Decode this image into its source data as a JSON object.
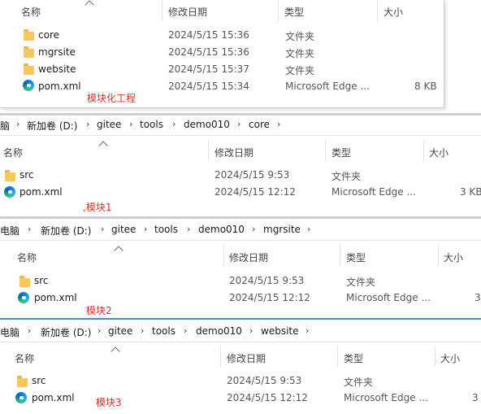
{
  "columns": {
    "name": "名称",
    "modified": "修改日期",
    "type": "类型",
    "size": "大小"
  },
  "panel1": {
    "rows": [
      {
        "name": "core",
        "date": "2024/5/15 15:36",
        "type": "文件夹",
        "size": "",
        "icon": "folder-icon"
      },
      {
        "name": "mgrsite",
        "date": "2024/5/15 15:36",
        "type": "文件夹",
        "size": "",
        "icon": "folder-icon"
      },
      {
        "name": "website",
        "date": "2024/5/15 15:37",
        "type": "文件夹",
        "size": "",
        "icon": "folder-icon"
      },
      {
        "name": "pom.xml",
        "date": "2024/5/15 15:34",
        "type": "Microsoft Edge ...",
        "size": "8 KB",
        "icon": "edge-file-icon"
      }
    ],
    "annotation": "模块化工程"
  },
  "panel2": {
    "breadcrumb": [
      "脑",
      "新加卷 (D:)",
      "gitee",
      "tools",
      "demo010",
      "core"
    ],
    "rows": [
      {
        "name": "src",
        "date": "2024/5/15 9:53",
        "type": "文件夹",
        "size": ""
      },
      {
        "name": "pom.xml",
        "date": "2024/5/15 12:12",
        "type": "Microsoft Edge ...",
        "size": "3 KB"
      }
    ],
    "annotation": ",模块1"
  },
  "panel3": {
    "breadcrumb": [
      "电脑",
      "新加卷 (D:)",
      "gitee",
      "tools",
      "demo010",
      "mgrsite"
    ],
    "rows": [
      {
        "name": "src",
        "date": "2024/5/15 9:53",
        "type": "文件夹",
        "size": ""
      },
      {
        "name": "pom.xml",
        "date": "2024/5/15 12:12",
        "type": "Microsoft Edge ...",
        "size": "3"
      }
    ],
    "annotation": "模块2"
  },
  "panel4": {
    "breadcrumb": [
      "电脑",
      "新加卷 (D:)",
      "gitee",
      "tools",
      "demo010",
      "website"
    ],
    "rows": [
      {
        "name": "src",
        "date": "2024/5/15 9:53",
        "type": "文件夹",
        "size": ""
      },
      {
        "name": "pom.xml",
        "date": "2024/5/15 12:12",
        "type": "Microsoft Edge ...",
        "size": "3"
      }
    ],
    "annotation": "模块3"
  },
  "colors": {
    "annotation": "#d9312b",
    "folder": "#f7c95c",
    "edge": "#0a7ad8"
  }
}
